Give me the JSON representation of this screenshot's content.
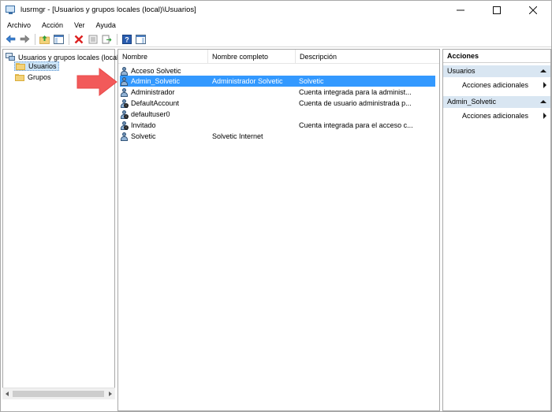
{
  "window": {
    "title": "lusrmgr - [Usuarios y grupos locales (local)\\Usuarios]",
    "minimize_icon": "minimize-icon",
    "maximize_icon": "maximize-icon",
    "close_icon": "close-icon"
  },
  "menu": {
    "items": [
      "Archivo",
      "Acción",
      "Ver",
      "Ayuda"
    ]
  },
  "toolbar": {
    "buttons": [
      "back-arrow-icon",
      "forward-arrow-icon",
      "up-folder-icon",
      "show-hide-tree-icon",
      "delete-icon",
      "properties-icon",
      "export-list-icon",
      "help-icon",
      "show-action-pane-icon"
    ]
  },
  "tree": {
    "root_label": "Usuarios y grupos locales (local)",
    "items": [
      {
        "label": "Usuarios",
        "selected": true
      },
      {
        "label": "Grupos",
        "selected": false
      }
    ]
  },
  "list": {
    "columns": [
      "Nombre",
      "Nombre completo",
      "Descripción"
    ],
    "rows": [
      {
        "name": "Acceso Solvetic",
        "full_name": "",
        "description": "",
        "selected": false
      },
      {
        "name": "Admin_Solvetic",
        "full_name": "Administrador Solvetic",
        "description": "Solvetic",
        "selected": true
      },
      {
        "name": "Administrador",
        "full_name": "",
        "description": "Cuenta integrada para la administ...",
        "selected": false
      },
      {
        "name": "DefaultAccount",
        "full_name": "",
        "description": "Cuenta de usuario administrada p...",
        "selected": false
      },
      {
        "name": "defaultuser0",
        "full_name": "",
        "description": "",
        "selected": false
      },
      {
        "name": "Invitado",
        "full_name": "",
        "description": "Cuenta integrada para el acceso c...",
        "selected": false
      },
      {
        "name": "Solvetic",
        "full_name": "Solvetic Internet",
        "description": "",
        "selected": false
      }
    ]
  },
  "actions": {
    "title": "Acciones",
    "groups": [
      {
        "label": "Usuarios",
        "item": "Acciones adicionales"
      },
      {
        "label": "Admin_Solvetic",
        "item": "Acciones adicionales"
      }
    ]
  },
  "colors": {
    "selection": "#3399ff",
    "annotation_arrow": "#f25a5a",
    "group_header": "#d9e6f2"
  }
}
